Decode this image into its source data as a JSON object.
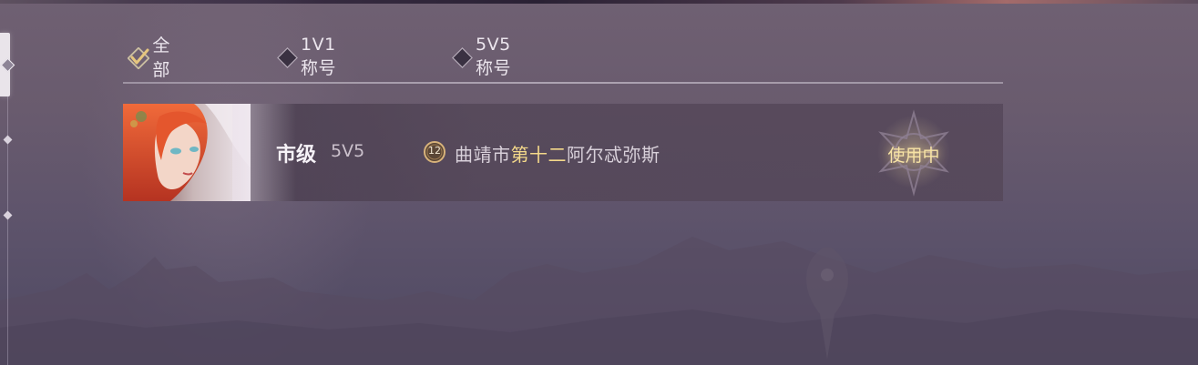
{
  "filters": [
    {
      "label": "全部",
      "selected": true
    },
    {
      "label": "1V1称号",
      "selected": false
    },
    {
      "label": "5V5称号",
      "selected": false
    }
  ],
  "titles": [
    {
      "level": "市级",
      "mode": "5V5",
      "badge_number": "12",
      "title_prefix": "曲靖市",
      "title_highlight": "第十二",
      "title_suffix": "阿尔忒弥斯",
      "status": "使用中"
    }
  ],
  "colors": {
    "highlight": "#f3d88a",
    "status": "#f7e3a5",
    "check": "#e6c67e"
  }
}
